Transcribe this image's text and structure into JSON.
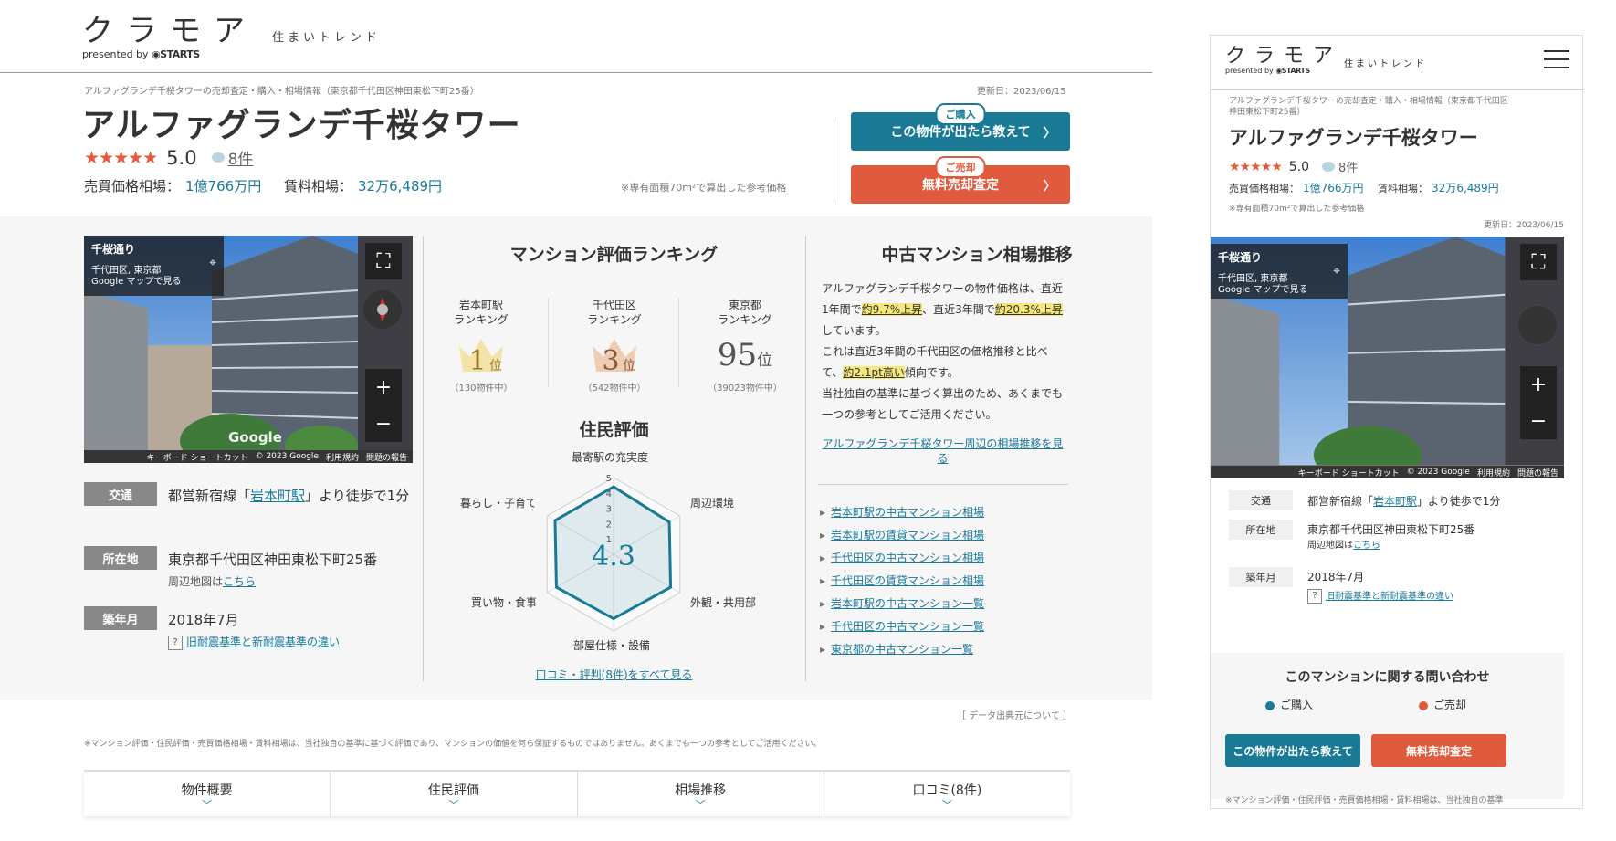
{
  "brand": {
    "logo_text": "クラモア",
    "presented_by": "presented by",
    "company": "STARTS",
    "tagline": "住まいトレンド"
  },
  "property": {
    "breadcrumb": "アルファグランデ千桜タワーの売却査定・購入・相場情報（東京都千代田区神田東松下町25番）",
    "updated": "更新日：2023/06/15",
    "name": "アルファグランデ千桜タワー",
    "stars": "★★★★★",
    "score": "5.0",
    "reviews": "8件",
    "sale_label": "売買価格相場：",
    "sale_value": "1億766万円",
    "rent_label": "賃料相場：",
    "rent_value": "32万6,489円",
    "area_note": "※専有面積70m²で算出した参考価格"
  },
  "cta": {
    "buy_pill": "ご購入",
    "buy_label": "この物件が出たら教えて",
    "sell_pill": "ご売却",
    "sell_label": "無料売却査定",
    "chevron": "〉"
  },
  "streetview": {
    "place": "千桜通り",
    "area": "千代田区, 東京都",
    "maps_link": "Google マップで見る",
    "zoom_in": "+",
    "zoom_out": "−",
    "fullscreen": "⛶",
    "google": "Google",
    "footer": [
      "キーボード ショートカット",
      "© 2023 Google",
      "利用規約",
      "問題の報告"
    ]
  },
  "details": {
    "access_tag": "交通",
    "access_pre": "都営新宿線「",
    "access_station": "岩本町駅",
    "access_post": "」より徒歩で1分",
    "address_tag": "所在地",
    "address": "東京都千代田区神田東松下町25番",
    "map_pre": "周辺地図は",
    "map_link": "こちら",
    "built_tag": "築年月",
    "built": "2018年7月",
    "quake_q": "?",
    "quake_link": "旧耐震基準と新耐震基準の違い"
  },
  "ranking": {
    "heading": "マンション評価ランキング",
    "items": [
      {
        "label1": "岩本町駅",
        "label2": "ランキング",
        "rank": "1",
        "suffix": "位",
        "count": "（130物件中）"
      },
      {
        "label1": "千代田区",
        "label2": "ランキング",
        "rank": "3",
        "suffix": "位",
        "count": "（542物件中）"
      },
      {
        "label1": "東京都",
        "label2": "ランキング",
        "rank": "95",
        "suffix": "位",
        "count": "（39023物件中）"
      }
    ]
  },
  "resident": {
    "heading": "住民評価",
    "score": "4.3",
    "ticks": [
      "1",
      "2",
      "3",
      "4",
      "5"
    ],
    "axes": [
      "最寄駅の充実度",
      "周辺環境",
      "外観・共用部",
      "部屋仕様・設備",
      "買い物・食事",
      "暮らし・子育て"
    ],
    "values": [
      4.4,
      4.2,
      4.3,
      4.2,
      4.3,
      4.4
    ],
    "max": 5,
    "all_reviews": "口コミ・評判(8件)をすべて見る"
  },
  "trend": {
    "heading": "中古マンション相場推移",
    "p1_a": "アルファグランデ千桜タワーの物件価格は、直近1年間で",
    "p1_hl1": "約9.7%上昇",
    "p1_b": "、直近3年間で",
    "p1_hl2": "約20.3%上昇",
    "p1_c": "しています。",
    "p2_a": "これは直近3年間の千代田区の価格推移と比べて、",
    "p2_hl": "約2.1pt高い",
    "p2_b": "傾向です。",
    "p3": "当社独自の基準に基づく算出のため、あくまでも一つの参考としてご活用ください。",
    "link": "アルファグランデ千桜タワー周辺の相場推移を見る",
    "list": [
      "岩本町駅の中古マンション相場",
      "岩本町駅の賃貸マンション相場",
      "千代田区の中古マンション相場",
      "千代田区の賃貸マンション相場",
      "岩本町駅の中古マンション一覧",
      "千代田区の中古マンション一覧",
      "東京都の中古マンション一覧"
    ]
  },
  "footer": {
    "data_source": "［ データ出典元について ］",
    "disclaimer": "※マンション評価・住民評価・売買価格相場・賃料相場は、当社独自の基準に基づく評価であり、マンションの価値を何ら保証するものではありません。あくまでも一つの参考としてご活用ください。",
    "disclaimer_short": "※マンション評価・住民評価・売買価格相場・賃料相場は、当社独自の基準",
    "tabs": [
      "物件概要",
      "住民評価",
      "相場推移",
      "口コミ(8件)"
    ],
    "tab_chevron": "﹀"
  },
  "mobile": {
    "breadcrumb1": "アルファグランデ千桜タワーの売却査定・購入・相場情報（東京都千代田区",
    "breadcrumb2": "神田東松下町25番）",
    "sale_label": "売買価格相場：",
    "rent_label": "賃料相場：",
    "inquiry_heading": "このマンションに関する問い合わせ",
    "buy_label": "ご購入",
    "sell_label": "ご売却",
    "buy_button": "この物件が出たら教えて",
    "sell_button": "無料売却査定"
  },
  "colors": {
    "teal": "#1a7a96",
    "orange": "#e05a3e",
    "star": "#e35a3e",
    "highlight": "#f5e77a"
  }
}
